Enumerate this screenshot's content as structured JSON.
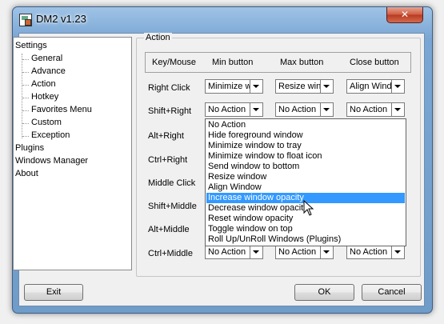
{
  "window": {
    "title": "DM2 v1.23",
    "close_glyph": "✕",
    "app_icon": "dm2-app-icon"
  },
  "tree": {
    "items": [
      {
        "label": "Settings"
      },
      {
        "label": "General"
      },
      {
        "label": "Advance"
      },
      {
        "label": "Action"
      },
      {
        "label": "Hotkey"
      },
      {
        "label": "Favorites Menu"
      },
      {
        "label": "Custom"
      },
      {
        "label": "Exception"
      },
      {
        "label": "Plugins"
      },
      {
        "label": "Windows Manager"
      },
      {
        "label": "About"
      }
    ]
  },
  "action": {
    "group_label": "Action",
    "headers": [
      "Key/Mouse",
      "Min button",
      "Max button",
      "Close button"
    ],
    "rows": [
      {
        "label": "Right Click",
        "min": "Minimize w",
        "max": "Resize win",
        "close": "Align Wind"
      },
      {
        "label": "Shift+Right",
        "min": "No Action",
        "max": "No Action",
        "close": "No Action"
      },
      {
        "label": "Alt+Right"
      },
      {
        "label": "Ctrl+Right"
      },
      {
        "label": "Middle Click"
      },
      {
        "label": "Shift+Middle"
      },
      {
        "label": "Alt+Middle"
      },
      {
        "label": "Ctrl+Middle",
        "min": "No Action",
        "max": "No Action",
        "close": "No Action"
      }
    ],
    "dropdown_options": [
      "No Action",
      "Hide foreground window",
      "Minimize window to tray",
      "Minimize window to float icon",
      "Send window to bottom",
      "Resize window",
      "Align Window",
      "Increase window opacity",
      "Decrease window opacity",
      "Reset window opacity",
      "Toggle window on top",
      "Roll Up/UnRoll Windows (Plugins)"
    ],
    "dropdown_selected": "Increase window opacity"
  },
  "buttons": {
    "exit": "Exit",
    "ok": "OK",
    "cancel": "Cancel"
  },
  "colors": {
    "selection": "#3399ff",
    "title_bar": "#7aa6d4",
    "close_button": "#c8452c"
  }
}
